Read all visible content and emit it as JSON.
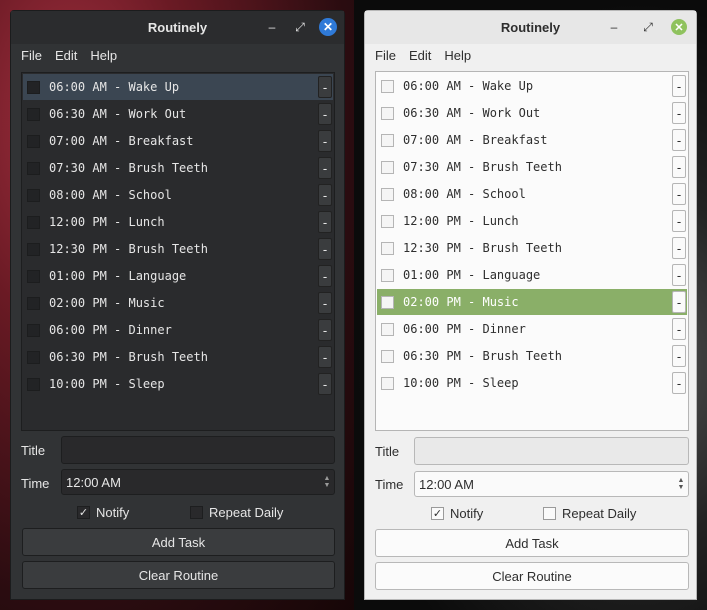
{
  "app": {
    "title": "Routinely"
  },
  "menu": {
    "file": "File",
    "edit": "Edit",
    "help": "Help"
  },
  "titlebar": {
    "minimize_icon": "–",
    "maximize_icon": "⤢",
    "close_icon": "✕"
  },
  "tasks": [
    "06:00 AM - Wake Up",
    "06:30 AM - Work Out",
    "07:00 AM - Breakfast",
    "07:30 AM - Brush Teeth",
    "08:00 AM - School",
    "12:00 PM - Lunch",
    "12:30 PM - Brush Teeth",
    "01:00 PM - Language",
    "02:00 PM - Music",
    "06:00 PM - Dinner",
    "06:30 PM - Brush Teeth",
    "10:00 PM - Sleep"
  ],
  "delete_label": "-",
  "form": {
    "title_label": "Title",
    "title_value": "",
    "time_label": "Time",
    "time_value": "12:00 AM",
    "notify_label": "Notify",
    "notify_checked": true,
    "repeat_label": "Repeat Daily",
    "repeat_checked": false,
    "check_mark": "✓",
    "spin_up": "▲",
    "spin_down": "▼"
  },
  "buttons": {
    "add": "Add Task",
    "clear": "Clear Routine"
  },
  "themes": {
    "dark": {
      "selected_index": 0,
      "accent": "#2f7ad8",
      "selection": "#3b4652"
    },
    "light": {
      "selected_index": 8,
      "accent": "#8fc25e",
      "selection": "#8aaf68"
    }
  }
}
